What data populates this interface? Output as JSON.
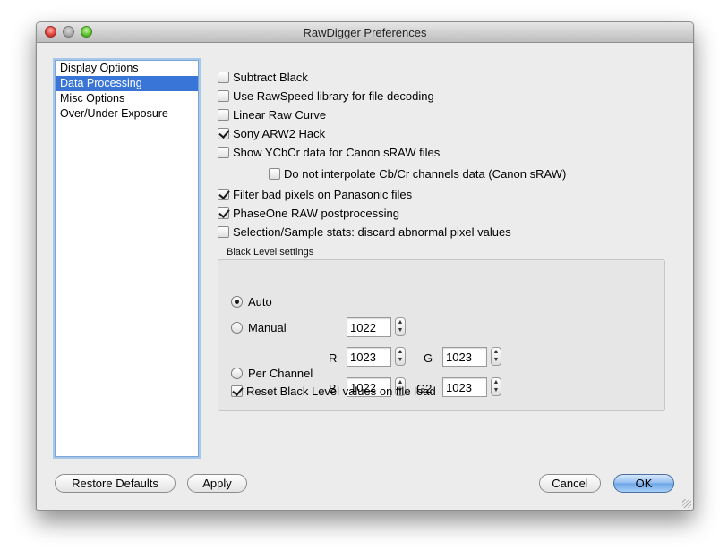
{
  "window": {
    "title": "RawDigger Preferences"
  },
  "sidebar": {
    "items": [
      {
        "label": "Display Options",
        "selected": false
      },
      {
        "label": "Data Processing",
        "selected": true
      },
      {
        "label": "Misc Options",
        "selected": false
      },
      {
        "label": "Over/Under Exposure",
        "selected": false
      }
    ]
  },
  "options": [
    {
      "label": "Subtract Black",
      "checked": false
    },
    {
      "label": "Use RawSpeed library for file decoding",
      "checked": false
    },
    {
      "label": "Linear Raw Curve",
      "checked": false
    },
    {
      "label": "Sony ARW2 Hack",
      "checked": true
    },
    {
      "label": "Show YCbCr data for Canon sRAW files",
      "checked": false
    },
    {
      "label": "Do not interpolate Cb/Cr channels data (Canon sRAW)",
      "checked": false
    },
    {
      "label": "Filter bad pixels on Panasonic files",
      "checked": true
    },
    {
      "label": "PhaseOne RAW postprocessing",
      "checked": true
    },
    {
      "label": "Selection/Sample stats: discard abnormal pixel values",
      "checked": false
    }
  ],
  "black_level": {
    "group_label": "Black Level settings",
    "mode": "auto",
    "auto_label": "Auto",
    "manual_label": "Manual",
    "manual_value": "1022",
    "per_channel_label": "Per Channel",
    "channels": {
      "r_label": "R",
      "r_value": "1023",
      "g_label": "G",
      "g_value": "1023",
      "b_label": "B",
      "b_value": "1022",
      "g2_label": "G2",
      "g2_value": "1023"
    },
    "reset_label": "Reset Black Level values on file load",
    "reset_checked": true
  },
  "buttons": {
    "restore_defaults": "Restore Defaults",
    "apply": "Apply",
    "cancel": "Cancel",
    "ok": "OK"
  },
  "icons": {
    "stepper_up": "▲",
    "stepper_down": "▼"
  }
}
